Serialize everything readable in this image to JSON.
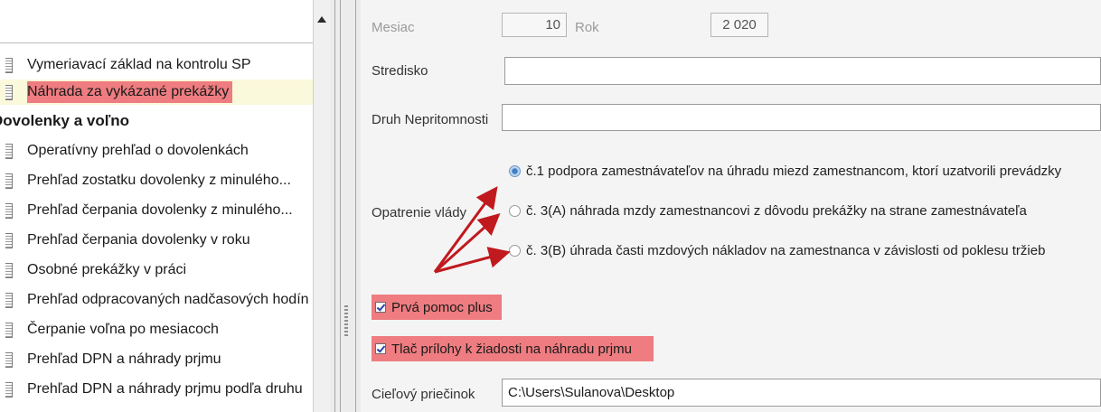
{
  "left_panel": {
    "items": [
      {
        "label": "Vymeriavací základ na kontrolu SP",
        "kind": "item"
      },
      {
        "label": "Náhrada za vykázané prekážky",
        "kind": "item",
        "highlighted": true
      },
      {
        "label": "Dovolenky a voľno",
        "kind": "group"
      },
      {
        "label": "Operatívny prehľad o dovolenkách",
        "kind": "item"
      },
      {
        "label": "Prehľad zostatku dovolenky z minulého...",
        "kind": "item"
      },
      {
        "label": "Prehľad čerpania dovolenky z minulého...",
        "kind": "item"
      },
      {
        "label": "Prehľad čerpania dovolenky v roku",
        "kind": "item"
      },
      {
        "label": "Osobné prekážky v práci",
        "kind": "item"
      },
      {
        "label": "Prehľad odpracovaných nadčasových hodín",
        "kind": "item"
      },
      {
        "label": "Čerpanie voľna po mesiacoch",
        "kind": "item"
      },
      {
        "label": "Prehľad DPN a náhrady prjmu",
        "kind": "item"
      },
      {
        "label": "Prehľad DPN a náhrady prjmu podľa druhu",
        "kind": "item"
      }
    ]
  },
  "form": {
    "mesiac_label": "Mesiac",
    "mesiac_value": "10",
    "rok_label": "Rok",
    "rok_value": "2 020",
    "stredisko_label": "Stredisko",
    "stredisko_value": "",
    "druh_label": "Druh Nepritomnosti",
    "druh_value": "",
    "opatrenie_label": "Opatrenie vlády",
    "radios": [
      {
        "label": "č.1 podpora zamestnávateľov na úhradu miezd zamestnancom, ktorí uzatvorili prevádzky",
        "selected": true
      },
      {
        "label": "č. 3(A) náhrada mzdy zamestnancovi z dôvodu prekážky na strane zamestnávateľa",
        "selected": false
      },
      {
        "label": "č. 3(B) úhrada časti mzdových nákladov na zamestnanca v závislosti od poklesu tržieb",
        "selected": false
      }
    ],
    "checkboxes": [
      {
        "label": "Prvá pomoc plus",
        "checked": true
      },
      {
        "label": "Tlač prílohy k žiadosti  na náhradu prjmu",
        "checked": true
      }
    ],
    "ciel_label": "Cieľový priečinok",
    "ciel_value": "C:\\Users\\Sulanova\\Desktop"
  },
  "colors": {
    "highlight": "#ee7c80",
    "arrow": "#c0191e",
    "selected_row_bg": "#fbf9db"
  }
}
